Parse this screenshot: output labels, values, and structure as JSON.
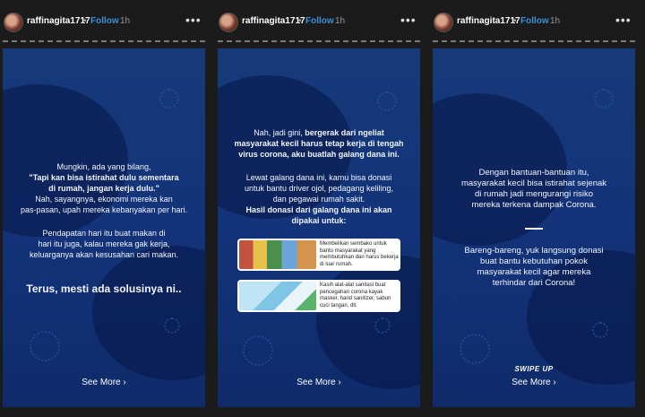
{
  "account": {
    "username": "raffinagita1717",
    "separator": "•",
    "follow_label": "Follow",
    "time": "1h",
    "more": "•••"
  },
  "see_more": "See More",
  "chevron": "›",
  "panel1": {
    "p1_line1": "Mungkin, ada yang bilang,",
    "p1_line2": "\"Tapi kan bisa istirahat dulu sementara",
    "p1_line3": "di rumah, jangan kerja dulu.\"",
    "p1_line4": "Nah, sayangnya, ekonomi mereka kan",
    "p1_line5": "pas-pasan, upah mereka kebanyakan per hari.",
    "p2_line1": "Pendapatan hari itu buat makan di",
    "p2_line2": "hari itu juga, kalau mereka gak kerja,",
    "p2_line3": "keluarganya akan kesusahan cari makan.",
    "headline": "Terus, mesti ada solusinya ni.."
  },
  "panel2": {
    "l1": "Nah, jadi gini, ",
    "l1b": "bergerak dari ngeliat",
    "l2": "masyarakat kecil harus tetap kerja di tengah",
    "l3": "virus corona, aku buatlah galang dana ini.",
    "l4": "Lewat galang dana ini, kamu bisa donasi",
    "l5": "untuk bantu driver ojol, pedagang keliling,",
    "l6": "dan pegawai rumah sakit.",
    "l7": "Hasil donasi dari galang dana ini akan",
    "l8": "dipakai untuk:",
    "cards": [
      {
        "text": "Membelikan sembako untuk bantu masyarakat yang membutuhkan dan harus bekerja di luar rumah."
      },
      {
        "text": "Kasih alat-alat sanitasi buat pencegahan corona kayak masker, hand sanitizer, sabun cuci tangan, dll."
      }
    ]
  },
  "panel3": {
    "l1": "Dengan bantuan-bantuan itu,",
    "l2": "masyarakat kecil bisa istirahat sejenak",
    "l3": "di rumah jadi mengurangi risiko",
    "l4": "mereka terkena dampak Corona.",
    "l5": "Bareng-bareng, yuk langsung donasi",
    "l6": "buat bantu kebutuhan pokok",
    "l7": "masyarakat kecil agar mereka",
    "l8": "terhindar dari Corona!",
    "swipe_up": "SWIPE UP"
  }
}
